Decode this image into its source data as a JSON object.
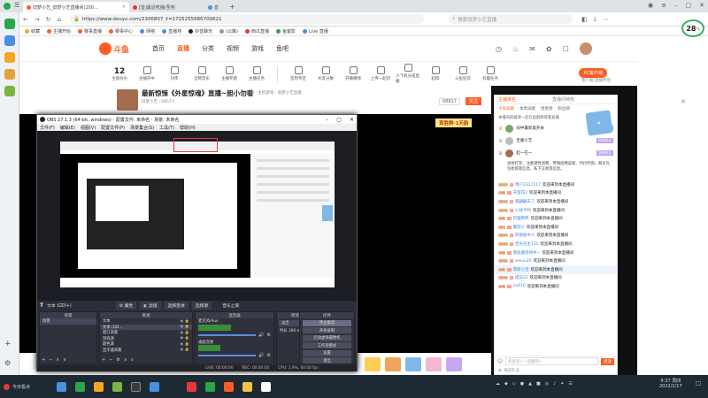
{
  "browser": {
    "tabs": [
      {
        "label": "旧梦小艺_旧梦小艺直播间(200..."
      },
      {
        "label": "[音]最近吃播/圣地"
      },
      {
        "label": "音"
      }
    ],
    "url": "https://www.douyu.com/2306807 ;t=1725255686700621",
    "search_placeholder": "搜索旧梦小艺直播",
    "bookmarks": [
      "收藏",
      "主播开始",
      "赛事直播",
      "赛事中心",
      "网络",
      "直播地",
      "抖音聊天",
      "(公策)",
      "西瓜直播",
      "鱼客影",
      "Live 直播"
    ]
  },
  "douyu": {
    "logo": "斗鱼",
    "nav": [
      "首页",
      "直播",
      "分类",
      "视频",
      "游戏",
      "鱼吧"
    ],
    "nav_active": 1,
    "user_title": "旧梦小艺",
    "level_num": "12",
    "level_label": "主播身份",
    "pc_button": "PC客户端",
    "download_label": "客户端·直播伴侣",
    "categories": [
      "主播开中",
      "功率",
      "全网音乐",
      "主播专题",
      "主播任务",
      "",
      "签到专区",
      "水友分数",
      "开播赚钱",
      "上传一起玩",
      "小飞机分成直播",
      "起碎",
      "斗鱼狂欢",
      "有趣任务"
    ],
    "room_title": "最新惊悚《外星惊魂》直播~胆小勿看",
    "room_meta": "奇幻 · 主机游戏 · 旧梦小艺直播",
    "room_sub": "旧梦小艺 · 6857人",
    "fans_count": "68817",
    "follow_label": "关注",
    "promo_text": "首胜鲜·1天韵",
    "rank_label": "主播排名",
    "rank_tab": "直播间特权"
  },
  "chat": {
    "tabs": [
      "今日贡献",
      "本周贡献",
      "周星榜",
      "粉丝榜"
    ],
    "active_tab": 0,
    "notice": "本播间的邀请一起在鱼群聊或看直播",
    "top_ranks": [
      {
        "name": "旧中最新奥开关",
        "badge": "超级粉丝"
      },
      {
        "name": "至蒙小艺 ",
        "badge": "超级粉丝"
      },
      {
        "name": "起一在一 ",
        "badge": "超级粉丝"
      }
    ],
    "system_msg": "进场打赏，注意理性消费，警惕招聘返现、代付代购、和买礼包抢购等信息，私下交易等信息。",
    "messages": [
      {
        "lv": "LV13",
        "fan": "0",
        "name": "用户2317217",
        "text": "欢迎来到本直播间"
      },
      {
        "lv": "LV8",
        "fan": "0",
        "name": "守望花2",
        "text": "欢迎来到本直播间"
      },
      {
        "lv": "LV12",
        "fan": "0",
        "name": "紫翩翩去了",
        "text": "欢迎来到本直播间"
      },
      {
        "lv": "LV11",
        "fan": "0",
        "name": "心动卡利",
        "text": "欢迎来到本直播间"
      },
      {
        "lv": "LV9",
        "fan": "0",
        "name": "阿狸熊熊",
        "text": "欢迎来到本直播间"
      },
      {
        "lv": "LV7",
        "fan": "0",
        "name": "蘑菇小",
        "text": "欢迎来到本直播间"
      },
      {
        "lv": "LV15",
        "fan": "0",
        "name": "阿德剧中人",
        "text": "欢迎来到本直播间"
      },
      {
        "lv": "LV10",
        "fan": "0",
        "name": "百天先生131",
        "text": "欢迎来到本直播间"
      },
      {
        "lv": "LV6",
        "fan": "0",
        "name": "我跑遍等待中~",
        "text": "欢迎来到本直播间"
      },
      {
        "lv": "LV12",
        "fan": "0",
        "name": "sesyu20",
        "text": "欢迎来到本直播间"
      },
      {
        "lv": "LV8",
        "fan": "0",
        "name": "萌新小宝",
        "text": "欢迎来到本直播间"
      },
      {
        "lv": "LV14",
        "fan": "0",
        "name": "提前32",
        "text": "欢迎来到本直播间"
      },
      {
        "lv": "LV9",
        "fan": "0",
        "name": "xx410",
        "text": "欢迎来到本直播间"
      }
    ],
    "input_placeholder": "和家里人一起聊吧~",
    "send_label": "发送",
    "gift_label": "每日礼法"
  },
  "weather": {
    "temp": "28",
    "unit": "°c"
  },
  "obs": {
    "title": "OBS 27.1.3 (64-bit, windows) - 配置文件: 未命名 - 场景: 未命名",
    "menu": [
      "文件(F)",
      "编辑(E)",
      "视图(V)",
      "配置文件(P)",
      "场景集合(S)",
      "工具(T)",
      "帮助(H)"
    ],
    "source_label": "文本 (GDI+)",
    "prop_buttons": [
      "属性",
      "滤镜",
      "选择变体",
      "选择源"
    ],
    "extra_label": "音乐之家",
    "docks": [
      {
        "title": "场景",
        "rows": [
          "场景"
        ]
      },
      {
        "title": "来源",
        "rows": [
          "文本",
          "文本 (GD...",
          "窗口采集",
          "游戏源",
          "颜色源",
          "显示器采集"
        ]
      },
      {
        "title": "混音器",
        "rows": [
          "麦克风/Aux",
          "桌面音频"
        ]
      },
      {
        "title": "转场特效",
        "rows": [
          "淡出",
          "时长 300 ms"
        ]
      },
      {
        "title": "控件",
        "rows": []
      }
    ],
    "mixer_levels": [
      0.45,
      0.3
    ],
    "control_buttons": [
      "停止推流",
      "开始录制",
      "启动虚拟摄像机",
      "工作室模式",
      "设置",
      "退出"
    ],
    "status": [
      "LIVE: 00:00:00",
      "REC: 00:00:00",
      "CPU: 1.9%, 60.00 fps"
    ]
  },
  "taskbar": {
    "start_label": "今日看点",
    "time": "9:37 周四",
    "date": "2022/2/17"
  },
  "colors": {
    "douyu_orange": "#ff5d23",
    "obs_dark": "#2b2e38",
    "taskbar": "#1d2a33"
  }
}
